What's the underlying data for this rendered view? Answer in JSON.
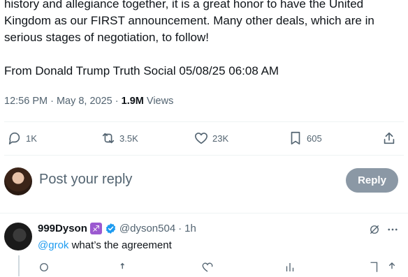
{
  "tweet": {
    "lines": [
      "history and allegiance together, it is a great honor to have the United",
      "Kingdom as our FIRST announcement. Many other deals, which are in",
      "serious stages of negotiation, to follow!"
    ],
    "source_line": "From Donald Trump Truth Social 05/08/25 06:08 AM",
    "timestamp": "12:56 PM · May 8, 2025 · ",
    "views_count": "1.9M",
    "views_label": " Views"
  },
  "actions": {
    "replies": "1K",
    "reposts": "3.5K",
    "likes": "23K",
    "bookmarks": "605"
  },
  "reply_composer": {
    "placeholder": "Post your reply",
    "button_label": "Reply"
  },
  "reply": {
    "display_name": "999Dyson",
    "badge_emoji": "♐",
    "handle": "@dyson504",
    "separator": "·",
    "time": "1h",
    "mention": "@grok",
    "text": " what’s the agreement"
  },
  "colors": {
    "text": "#0f1419",
    "secondary": "#536471",
    "accent": "#1d9bf0",
    "reply_button_disabled": "#8b98a5"
  }
}
